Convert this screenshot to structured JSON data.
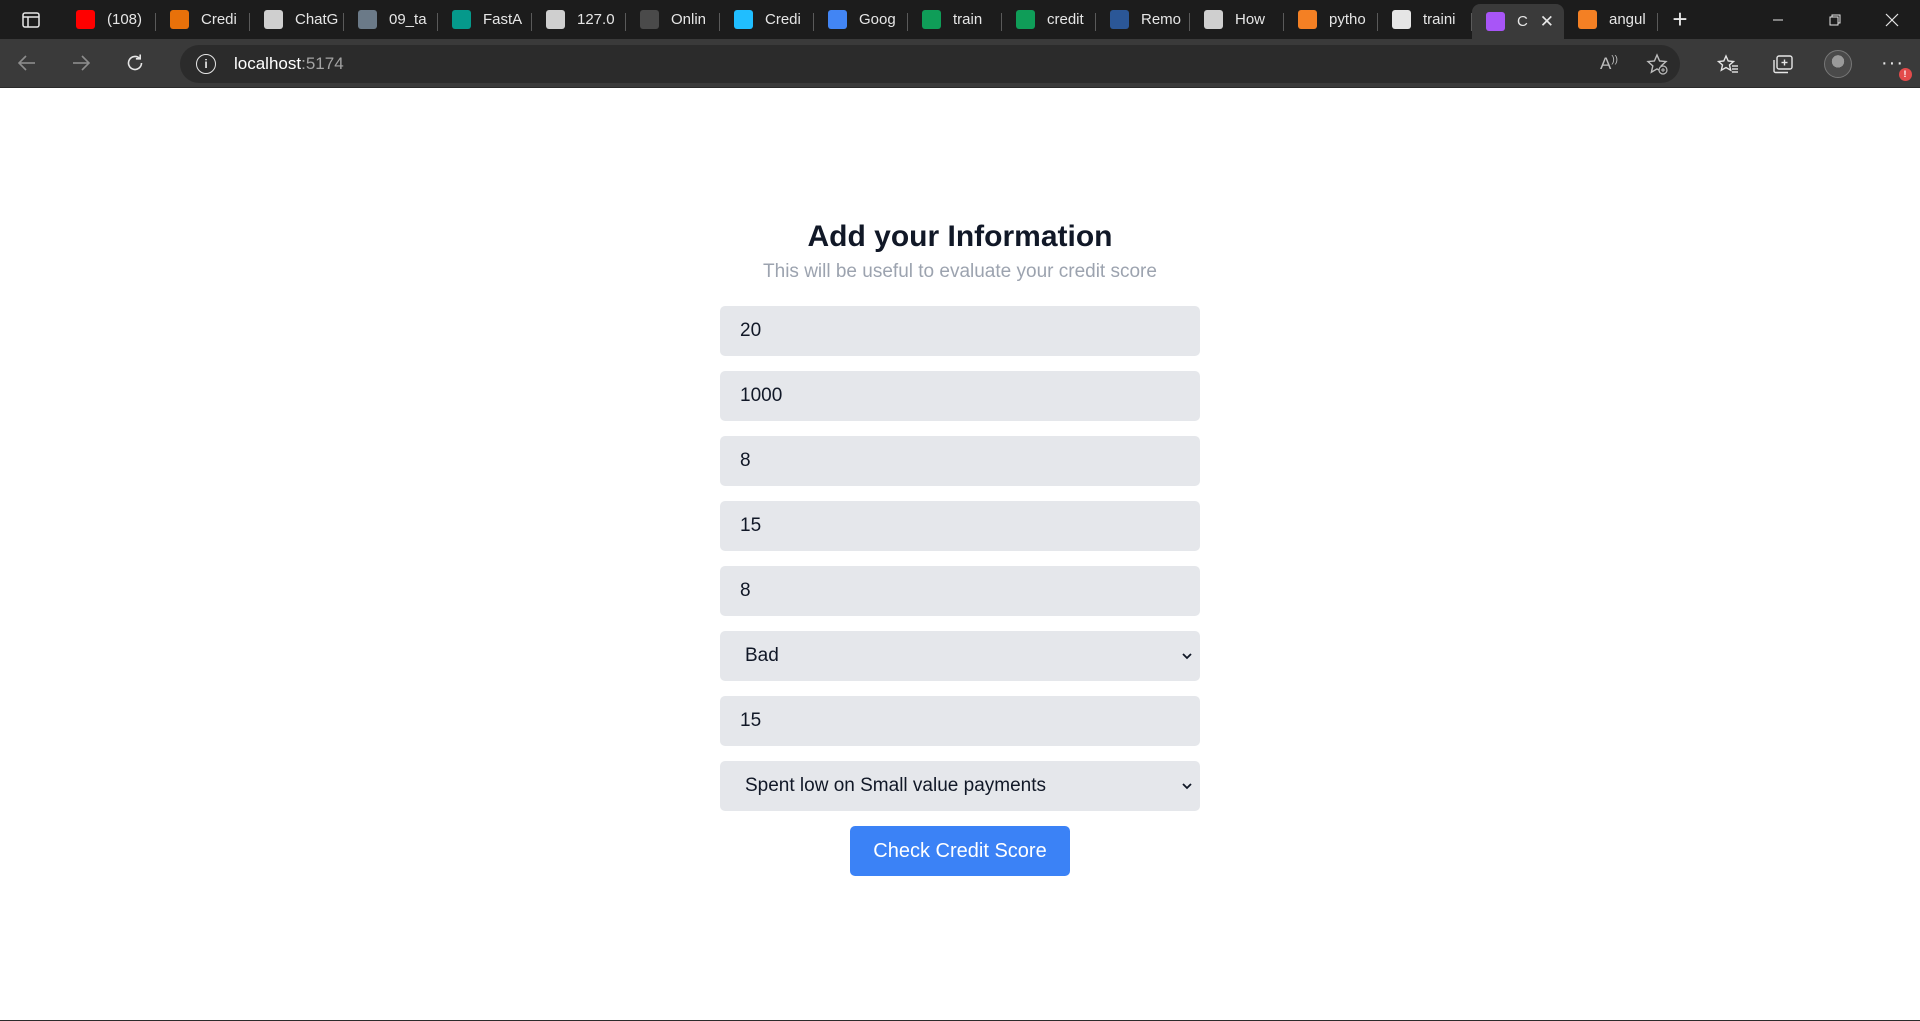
{
  "browser": {
    "tabs": [
      {
        "label": "(108)",
        "icon": "youtube-icon",
        "color": "#ff0000"
      },
      {
        "label": "Credi",
        "icon": "colab-icon",
        "color": "#e8710a"
      },
      {
        "label": "ChatG",
        "icon": "openai-icon",
        "color": "#cfcfcf"
      },
      {
        "label": "09_ta",
        "icon": "image-thumbnail-icon",
        "color": "#6b7a88"
      },
      {
        "label": "FastA",
        "icon": "fastapi-icon",
        "color": "#05998b"
      },
      {
        "label": "127.0",
        "icon": "document-icon",
        "color": "#cfcfcf"
      },
      {
        "label": "Onlin",
        "icon": "letter-e-icon",
        "color": "#4a4a4a"
      },
      {
        "label": "Credi",
        "icon": "kaggle-icon",
        "color": "#20beff"
      },
      {
        "label": "Goog",
        "icon": "google-docs-icon",
        "color": "#4285f4"
      },
      {
        "label": "train",
        "icon": "google-sheets-icon",
        "color": "#0f9d58"
      },
      {
        "label": "credit",
        "icon": "google-sheets-icon",
        "color": "#0f9d58"
      },
      {
        "label": "Remo",
        "icon": "letter-a-icon",
        "color": "#2b5797"
      },
      {
        "label": "How",
        "icon": "article-icon",
        "color": "#cfcfcf"
      },
      {
        "label": "pytho",
        "icon": "stackoverflow-icon",
        "color": "#f48024"
      },
      {
        "label": "traini",
        "icon": "document-search-icon",
        "color": "#e6e6e6"
      },
      {
        "label": "C",
        "icon": "vite-icon",
        "color": "#a855f7",
        "active": true
      },
      {
        "label": "angul",
        "icon": "stackoverflow-icon",
        "color": "#f48024"
      }
    ],
    "url_host": "localhost",
    "url_port": ":5174"
  },
  "form": {
    "title": "Add your Information",
    "subtitle": "This will be useful to evaluate your credit score",
    "fields": [
      {
        "type": "input",
        "value": "20"
      },
      {
        "type": "input",
        "value": "1000"
      },
      {
        "type": "input",
        "value": "8"
      },
      {
        "type": "input",
        "value": "15"
      },
      {
        "type": "input",
        "value": "8"
      },
      {
        "type": "select",
        "value": "Bad"
      },
      {
        "type": "input",
        "value": "15"
      },
      {
        "type": "select",
        "value": "Spent low on Small value payments"
      }
    ],
    "submit_label": "Check Credit Score"
  },
  "colors": {
    "accent": "#3b82f6",
    "field_bg": "#e5e7eb",
    "subtitle": "#9ca3af"
  }
}
